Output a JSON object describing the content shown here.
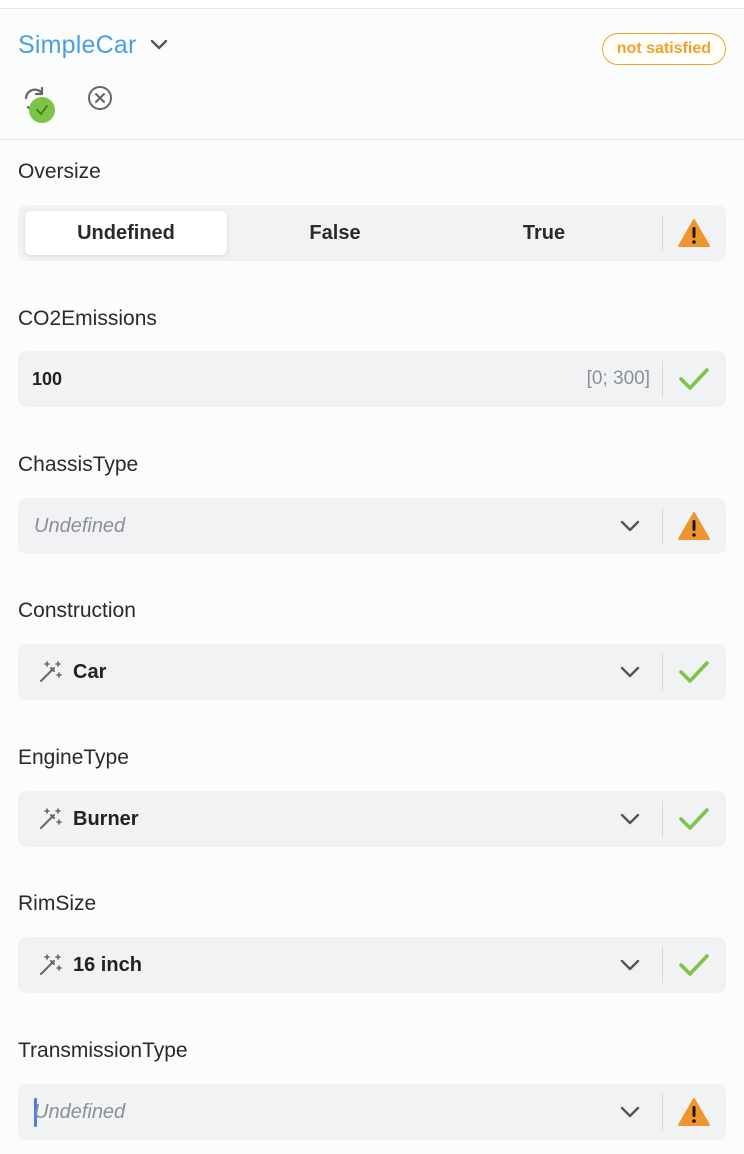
{
  "header": {
    "title": "SimpleCar",
    "status": "not satisfied",
    "colors": {
      "title": "#4a9fe0",
      "status": "#f0a22e",
      "ok": "#7cc346",
      "warn": "#f0952e"
    },
    "icons": {
      "title_toggle": "chevron-down-icon",
      "reload": "reload-icon",
      "reload_badge": "check-circle-icon",
      "clear": "close-circle-icon"
    }
  },
  "fields": {
    "oversize": {
      "label": "Oversize",
      "options": [
        "Undefined",
        "False",
        "True"
      ],
      "selected": "Undefined",
      "status": "warning"
    },
    "co2": {
      "label": "CO2Emissions",
      "value": "100",
      "range": "[0; 300]",
      "status": "ok"
    },
    "chassis": {
      "label": "ChassisType",
      "value": "Undefined",
      "status": "warning"
    },
    "construction": {
      "label": "Construction",
      "value": "Car",
      "status": "ok"
    },
    "engine": {
      "label": "EngineType",
      "value": "Burner",
      "status": "ok"
    },
    "rim": {
      "label": "RimSize",
      "value": "16 inch",
      "status": "ok"
    },
    "transmission": {
      "label": "TransmissionType",
      "value": "Undefined",
      "status": "warning"
    }
  }
}
